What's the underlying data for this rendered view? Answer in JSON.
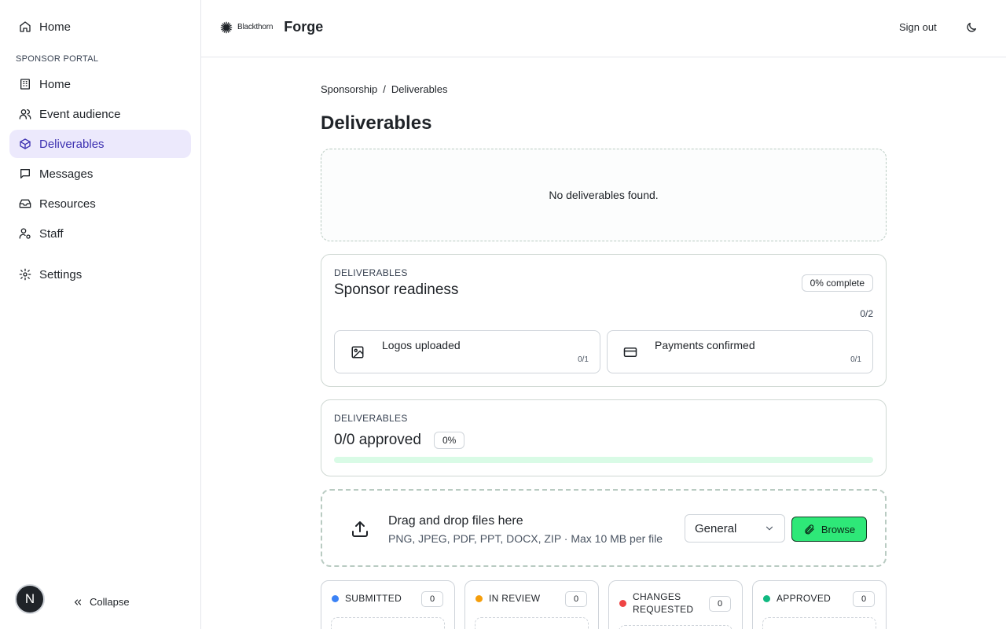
{
  "sidebar": {
    "top_home": "Home",
    "section_label": "SPONSOR PORTAL",
    "items": [
      {
        "label": "Home",
        "icon": "building-icon"
      },
      {
        "label": "Event audience",
        "icon": "users-icon"
      },
      {
        "label": "Deliverables",
        "icon": "package-icon",
        "active": true
      },
      {
        "label": "Messages",
        "icon": "message-icon"
      },
      {
        "label": "Resources",
        "icon": "inbox-icon"
      },
      {
        "label": "Staff",
        "icon": "user-cog-icon"
      }
    ],
    "settings": "Settings",
    "avatar_initial": "N",
    "collapse": "Collapse"
  },
  "header": {
    "company": "Blackthorn",
    "product": "Forge",
    "sign_out": "Sign out",
    "theme_icon": "moon-icon"
  },
  "breadcrumb": {
    "parent": "Sponsorship",
    "separator": "/",
    "current": "Deliverables"
  },
  "page_title": "Deliverables",
  "empty_state": "No deliverables found.",
  "readiness": {
    "eyebrow": "DELIVERABLES",
    "title": "Sponsor readiness",
    "badge": "0% complete",
    "count": "0/2",
    "items": [
      {
        "label": "Logos uploaded",
        "count": "0/1",
        "icon": "image-icon"
      },
      {
        "label": "Payments confirmed",
        "count": "0/1",
        "icon": "credit-card-icon"
      }
    ]
  },
  "approval": {
    "eyebrow": "DELIVERABLES",
    "title": "0/0 approved",
    "badge": "0%",
    "progress": 0
  },
  "upload": {
    "title": "Drag and drop files here",
    "subtitle": "PNG, JPEG, PDF, PPT, DOCX, ZIP · Max 10 MB per file",
    "category": "General",
    "browse": "Browse"
  },
  "kanban": [
    {
      "title": "SUBMITTED",
      "count": "0",
      "color": "#3b82f6"
    },
    {
      "title": "IN REVIEW",
      "count": "0",
      "color": "#f59e0b"
    },
    {
      "title": "CHANGES REQUESTED",
      "count": "0",
      "color": "#ef4444"
    },
    {
      "title": "APPROVED",
      "count": "0",
      "color": "#10b981"
    }
  ],
  "colors": {
    "accent": "#3b2fb0",
    "active_bg": "#ece9fc",
    "browse_bg": "#2ee878",
    "progress_track": "#d9fbe6"
  }
}
